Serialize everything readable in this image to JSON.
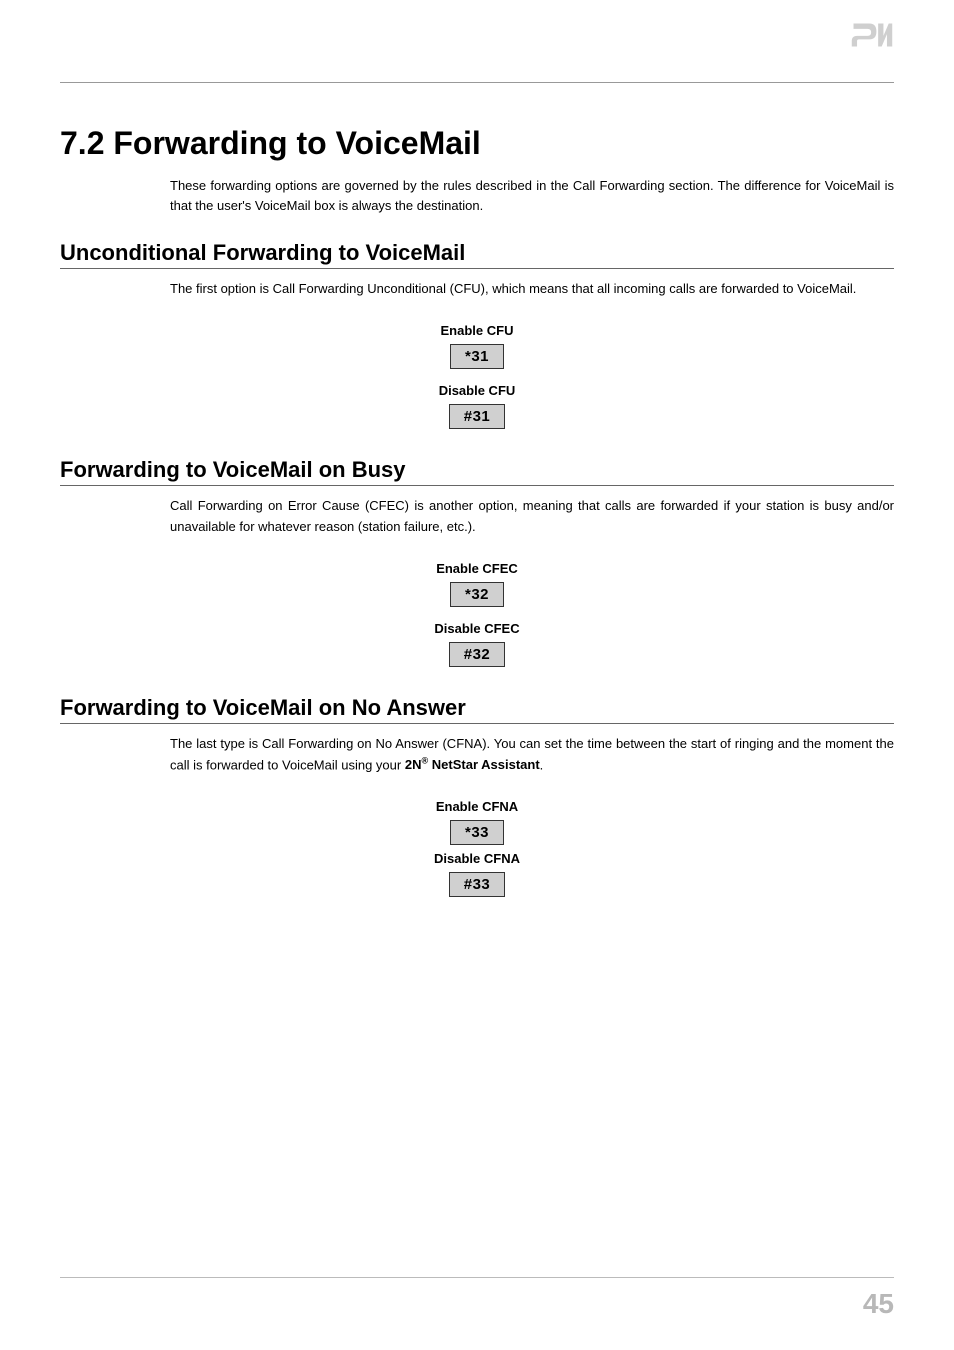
{
  "page": {
    "title": "7.2 Forwarding to VoiceMail",
    "intro": "These forwarding options are governed by the rules described in the Call Forwarding section. The difference for VoiceMail is that the user's VoiceMail box is always the destination.",
    "page_number": "45"
  },
  "sections": [
    {
      "heading": "Unconditional Forwarding to VoiceMail",
      "text": "The first option is Call Forwarding Unconditional (CFU), which means that all incoming calls are forwarded to VoiceMail.",
      "codes": [
        {
          "label": "Enable CFU",
          "code": "*31"
        },
        {
          "label": "Disable CFU",
          "code": "#31"
        }
      ]
    },
    {
      "heading": "Forwarding to VoiceMail on Busy",
      "text": "Call Forwarding on Error Cause (CFEC) is another option, meaning that calls are forwarded if your station is busy and/or unavailable for whatever reason (station failure, etc.).",
      "codes": [
        {
          "label": "Enable CFEC",
          "code": "*32"
        },
        {
          "label": "Disable CFEC",
          "code": "#32"
        }
      ]
    },
    {
      "heading": "Forwarding to VoiceMail on No Answer",
      "text_pre": "The last type is Call Forwarding on No Answer (CFNA). You can set the time between the start of ringing and the moment the call is forwarded to VoiceMail using your ",
      "brand": "2N",
      "brand_sup": "®",
      "text_post": " NetStar Assistant",
      "text_end": ".",
      "codes": [
        {
          "label": "Enable CFNA",
          "code": "*33"
        },
        {
          "label": "Disable CFNA",
          "code": "#33"
        }
      ]
    }
  ]
}
